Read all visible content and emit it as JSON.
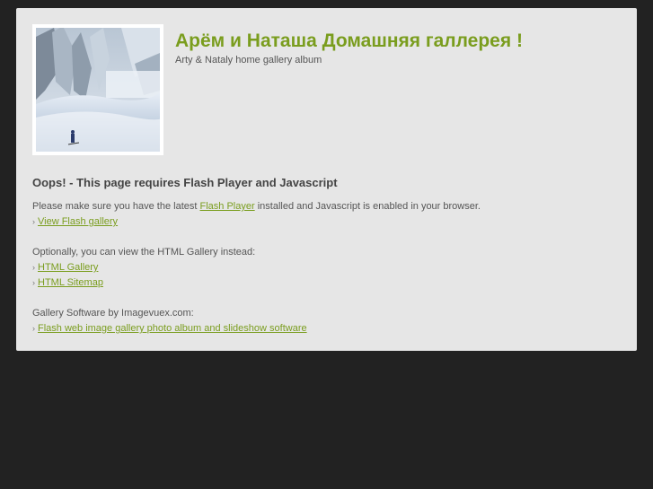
{
  "header": {
    "title": "Арём и Наташа Домашняя галлерея !",
    "subtitle": "Arty & Nataly home gallery album",
    "thumbnail_alt": "snowy forest with skier"
  },
  "notice": {
    "heading": "Oops! - This page requires Flash Player and Javascript",
    "text_before": "Please make sure you have the latest",
    "flash_player_link": "Flash Player",
    "text_after": "installed and Javascript is enabled in your browser.",
    "bullet": "›",
    "view_flash_link": "View Flash gallery",
    "optional_text": "Optionally, you can view the HTML Gallery instead:",
    "html_gallery_link": "HTML Gallery",
    "html_sitemap_link": "HTML Sitemap",
    "software_text": "Gallery Software by Imagevuex.com:",
    "software_link": "Flash web image gallery photo album and slideshow software"
  },
  "colors": {
    "page_bg": "#222222",
    "panel_bg": "#e6e6e6",
    "accent": "#7a9d1e",
    "text": "#555555"
  }
}
